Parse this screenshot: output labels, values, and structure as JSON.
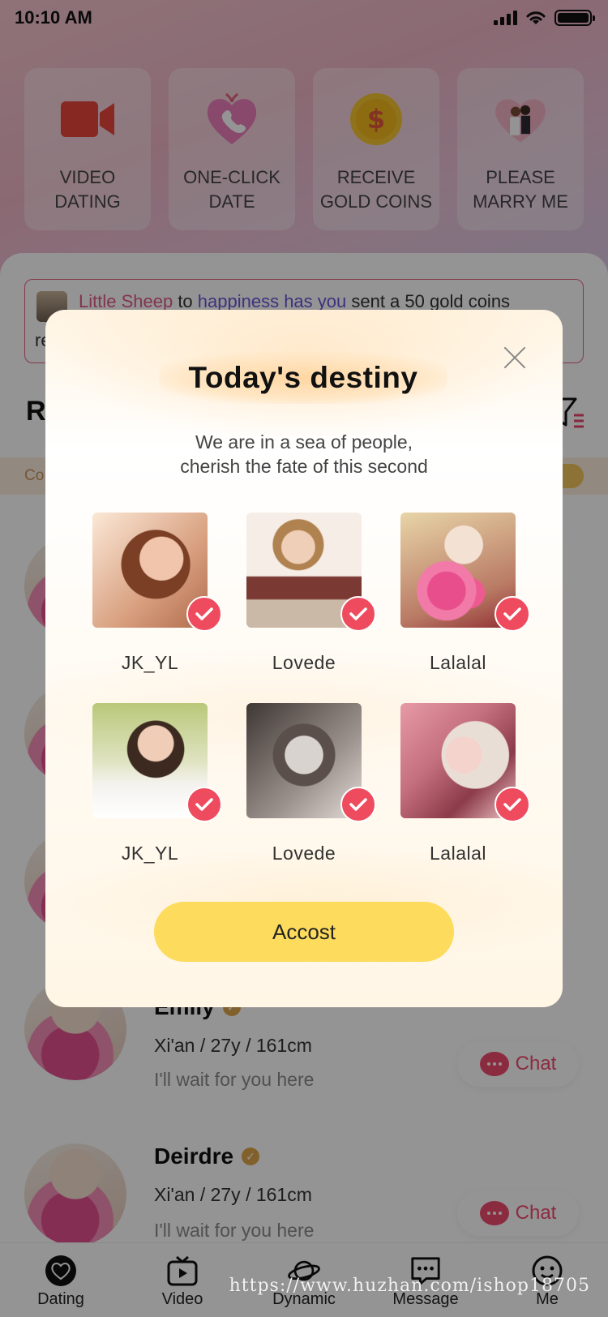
{
  "status_bar": {
    "time": "10:10 AM"
  },
  "quick_actions": [
    {
      "label": "VIDEO\nDATING",
      "icon": "video-camera-icon"
    },
    {
      "label": "ONE-CLICK\nDATE",
      "icon": "heart-phone-icon"
    },
    {
      "label": "RECEIVE\nGOLD COINS",
      "icon": "gold-coin-icon"
    },
    {
      "label": "PLEASE\nMARRY ME",
      "icon": "couple-heart-icon"
    }
  ],
  "marquee": {
    "user_from": "Little Sheep",
    "connector": " to ",
    "user_to": "happiness has you",
    "message": "  sent a 50 gold coins",
    "line2": "re"
  },
  "section": {
    "title": "R"
  },
  "notice": {
    "text": "Co"
  },
  "users": [
    {
      "name": "Emily",
      "meta": "Xi'an / 27y / 161cm",
      "sign": "I'll wait for you here",
      "chat_label": "Chat"
    },
    {
      "name": "Deirdre",
      "meta": "Xi'an / 27y / 161cm",
      "sign": "I'll wait for you here",
      "chat_label": "Chat"
    }
  ],
  "tab_bar": [
    {
      "label": "Dating",
      "icon": "heart-icon"
    },
    {
      "label": "Video",
      "icon": "tv-icon"
    },
    {
      "label": "Dynamic",
      "icon": "planet-icon"
    },
    {
      "label": "Message",
      "icon": "message-icon"
    },
    {
      "label": "Me",
      "icon": "smiley-icon"
    }
  ],
  "modal": {
    "title": "Today's destiny",
    "subtitle": "We are in a sea of people,\ncherish the fate of this second",
    "people": [
      {
        "name": "JK_YL",
        "selected": true
      },
      {
        "name": "Lovede",
        "selected": true
      },
      {
        "name": "Lalalal",
        "selected": true
      },
      {
        "name": "JK_YL",
        "selected": true
      },
      {
        "name": "Lovede",
        "selected": true
      },
      {
        "name": "Lalalal",
        "selected": true
      }
    ],
    "button_label": "Accost"
  },
  "watermark": "https://www.huzhan.com/ishop18705",
  "colors": {
    "accent_pink": "#ef4a6e",
    "check_red": "#ef4b5e",
    "button_yellow": "#fddb5c",
    "verify_gold": "#e0a54a"
  }
}
